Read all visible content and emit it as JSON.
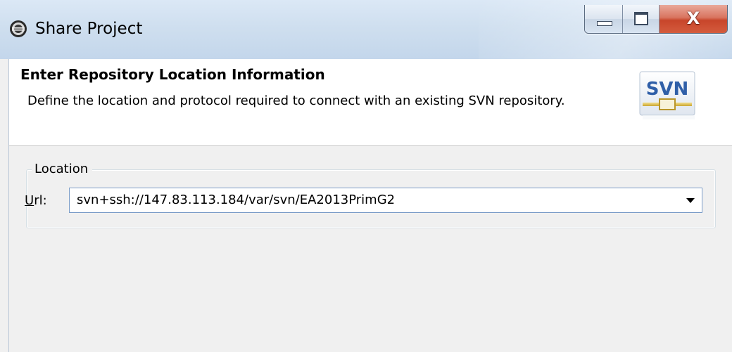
{
  "window": {
    "title": "Share Project",
    "app_icon": "eclipse-icon",
    "controls": {
      "minimize_icon": "minimize-icon",
      "maximize_icon": "maximize-icon",
      "close_label": "X"
    }
  },
  "header": {
    "title": "Enter Repository Location Information",
    "description": "Define the location and protocol required to connect with an existing SVN repository.",
    "logo": {
      "text": "SVN",
      "icon": "svn-logo-icon"
    }
  },
  "location": {
    "group_label": "Location",
    "url_label_mnemonic": "U",
    "url_label_rest": "rl:",
    "url_value": "svn+ssh://147.83.113.184/var/svn/EA2013PrimG2",
    "dropdown_icon": "chevron-down-icon"
  },
  "colors": {
    "titlebar": "#cfdfef",
    "close_button": "#c8452a",
    "combo_border": "#7a9cc8",
    "svn_blue": "#2f5fa8",
    "svn_gold": "#d6b84a"
  }
}
